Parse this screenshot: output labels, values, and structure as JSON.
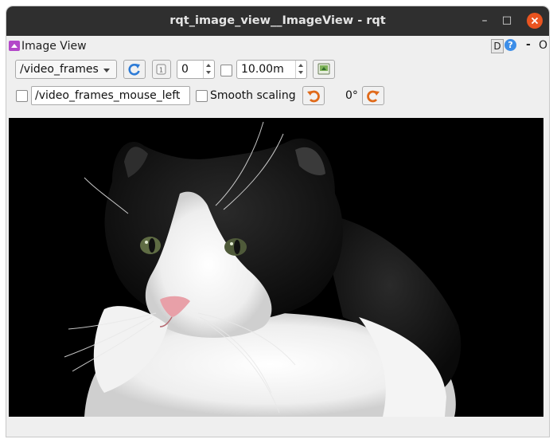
{
  "window": {
    "title": "rqt_image_view__ImageView - rqt",
    "minimize_glyph": "–",
    "maximize_glyph": "□"
  },
  "panel": {
    "name": "Image View",
    "d_label": "D",
    "help_label": "?",
    "dash_label": "-",
    "o_label": "O"
  },
  "toolbar": {
    "topic": "/video_frames",
    "spin_value": "0",
    "period": "10.00m",
    "mouse_topic": "/video_frames_mouse_left",
    "smooth_scaling_label": "Smooth scaling",
    "rotation": "0°"
  },
  "image": {
    "subject": "black-and-white cat on black background"
  }
}
